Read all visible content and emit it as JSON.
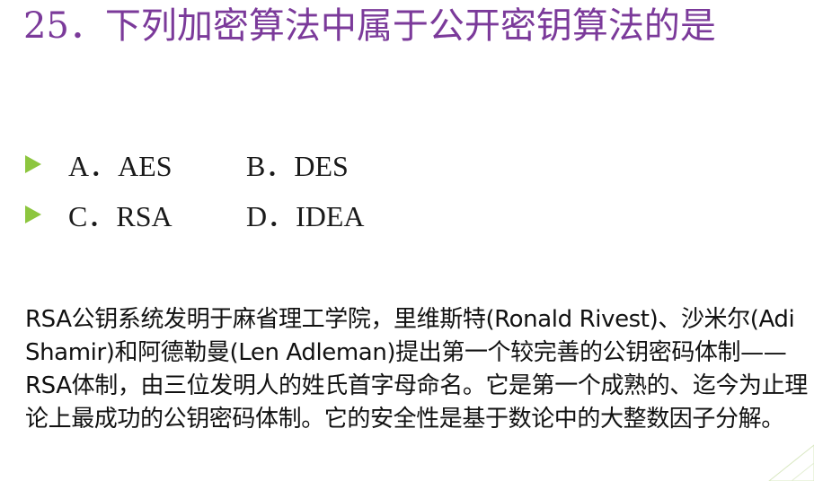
{
  "question": {
    "text": "25．下列加密算法中属于公开密钥算法的是"
  },
  "options": [
    {
      "label": "A．AES"
    },
    {
      "label": "B．DES"
    },
    {
      "label": "C．RSA"
    },
    {
      "label": "D．IDEA"
    }
  ],
  "explanation": {
    "text": "RSA公钥系统发明于麻省理工学院，里维斯特(Ronald Rivest)、沙米尔(Adi Shamir)和阿德勒曼(Len Adleman)提出第一个较完善的公钥密码体制——RSA体制，由三位发明人的姓氏首字母命名。它是第一个成熟的、迄今为止理论上最成功的公钥密码体制。它的安全性是基于数论中的大整数因子分解。"
  },
  "colors": {
    "title": "#7B3A9A",
    "bullet": "#8DC63F",
    "text": "#111111"
  }
}
